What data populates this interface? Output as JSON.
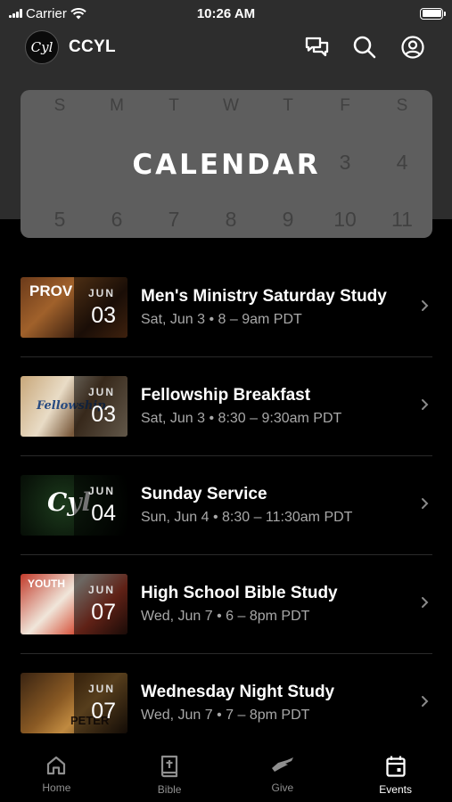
{
  "status_bar": {
    "carrier": "Carrier",
    "time": "10:26 AM"
  },
  "header": {
    "logo_text": "Cyl",
    "title": "CCYL"
  },
  "calendar_banner": {
    "title": "CALENDAR",
    "weekdays": [
      "S",
      "M",
      "T",
      "W",
      "T",
      "F",
      "S"
    ],
    "row_top": [
      "",
      "",
      "",
      "",
      "",
      "3",
      "4"
    ],
    "row_bottom": [
      "5",
      "6",
      "7",
      "8",
      "9",
      "10",
      "11"
    ]
  },
  "events": [
    {
      "title": "Men's Ministry Saturday Study",
      "time": "Sat, Jun 3 • 8 – 9am PDT",
      "month": "JUN",
      "day": "03",
      "thumb_text": "PROV",
      "thumb_style": "prov"
    },
    {
      "title": "Fellowship Breakfast",
      "time": "Sat, Jun 3 • 8:30 – 9:30am PDT",
      "month": "JUN",
      "day": "03",
      "thumb_text": "Fellowship",
      "thumb_style": "breakfast"
    },
    {
      "title": "Sunday Service",
      "time": "Sun, Jun 4 • 8:30 – 11:30am PDT",
      "month": "JUN",
      "day": "04",
      "thumb_text": "Cyl",
      "thumb_style": "sunday"
    },
    {
      "title": "High School Bible Study",
      "time": "Wed, Jun 7 • 6 – 8pm PDT",
      "month": "JUN",
      "day": "07",
      "thumb_text": "YOUTH",
      "thumb_style": "youth"
    },
    {
      "title": "Wednesday Night Study",
      "time": "Wed, Jun 7 • 7 – 8pm PDT",
      "month": "JUN",
      "day": "07",
      "thumb_text": "PETER",
      "thumb_style": "peter"
    }
  ],
  "tabs": [
    {
      "label": "Home",
      "icon": "home-icon",
      "active": false
    },
    {
      "label": "Bible",
      "icon": "bible-icon",
      "active": false
    },
    {
      "label": "Give",
      "icon": "give-icon",
      "active": false
    },
    {
      "label": "Events",
      "icon": "calendar-icon",
      "active": true
    }
  ],
  "colors": {
    "header_bg": "#2d2d2d",
    "calendar_card": "#5e5e5e",
    "muted_text": "#a8a8a8",
    "active_tab": "#ffffff",
    "inactive_tab": "#8f8f8f"
  }
}
